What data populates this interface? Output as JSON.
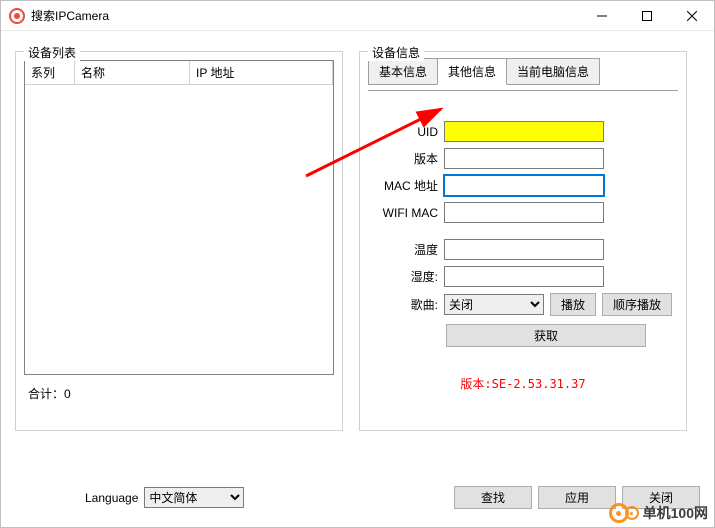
{
  "window": {
    "title": "搜索IPCamera"
  },
  "left": {
    "legend": "设备列表",
    "cols": {
      "series": "系列",
      "name": "名称",
      "ip": "IP 地址"
    },
    "total_label": "合计：",
    "total_value": "0"
  },
  "right": {
    "legend": "设备信息",
    "tabs": {
      "basic": "基本信息",
      "other": "其他信息",
      "pc": "当前电脑信息"
    },
    "fields": {
      "uid": "UID",
      "version": "版本",
      "mac": "MAC 地址",
      "wifimac": "WIFI MAC",
      "temp": "温度",
      "humidity": "湿度:",
      "song": "歌曲:"
    },
    "song_select": "关闭",
    "play_btn": "播放",
    "seq_play_btn": "顺序播放",
    "fetch_btn": "获取",
    "version_text": "版本:SE-2.53.31.37"
  },
  "bottom": {
    "language_label": "Language",
    "language_value": "中文简体",
    "search_btn": "查找",
    "apply_btn": "应用",
    "close_btn": "关闭"
  },
  "watermark": "单机100网"
}
